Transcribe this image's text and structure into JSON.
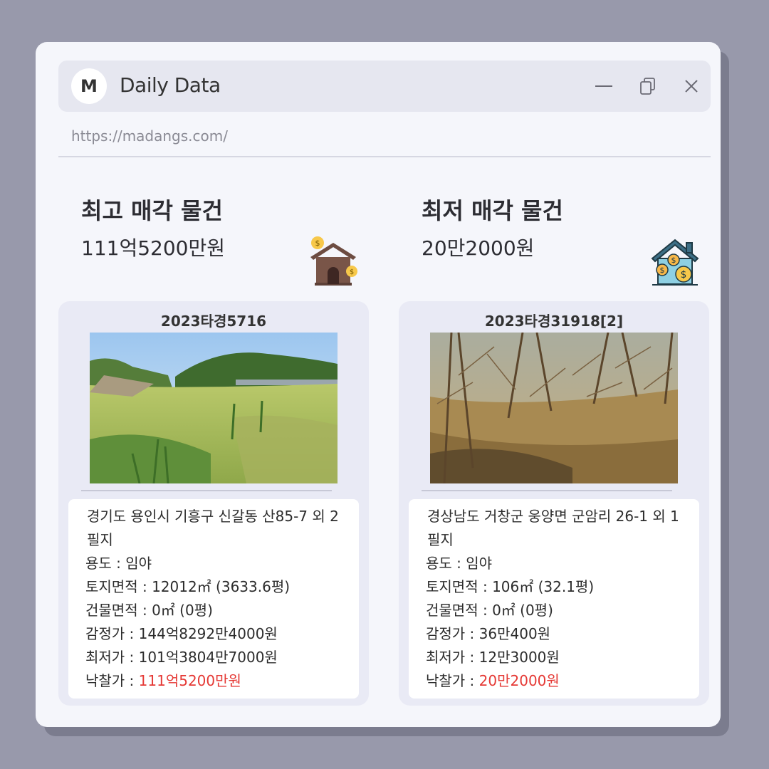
{
  "window": {
    "avatar_letter": "M",
    "title": "Daily Data",
    "url": "https://madangs.com/"
  },
  "highest": {
    "heading": "최고 매각 물건",
    "price": "111억5200만원",
    "case_id": "2023타경5716",
    "address": "경기도 용인시 기흥구 신갈동 산85-7 외 2 필지",
    "usage_label": "용도 : ",
    "usage": "임야",
    "land_label": "토지면적 : ",
    "land_area": "12012㎡ (3633.6평)",
    "building_label": "건물면적 : ",
    "building_area": "0㎡ (0평)",
    "appraisal_label": "감정가 : ",
    "appraisal": "144억8292만4000원",
    "minimum_label": "최저가 : ",
    "minimum": "101억3804만7000원",
    "winning_label": "낙찰가 : ",
    "winning": "111억5200만원"
  },
  "lowest": {
    "heading": "최저 매각 물건",
    "price": "20만2000원",
    "case_id": "2023타경31918[2]",
    "address": "경상남도 거창군 웅양면 군암리 26-1 외 1 필지",
    "usage_label": "용도 : ",
    "usage": "임야",
    "land_label": "토지면적 : ",
    "land_area": "106㎡ (32.1평)",
    "building_label": "건물면적 : ",
    "building_area": "0㎡ (0평)",
    "appraisal_label": "감정가 : ",
    "appraisal": "36만400원",
    "minimum_label": "최저가 : ",
    "minimum": "12만3000원",
    "winning_label": "낙찰가 : ",
    "winning": "20만2000원"
  },
  "icons": {
    "minimize": "minimize-icon",
    "copy": "copy-icon",
    "close": "close-icon",
    "house_money": "house-money-icon",
    "house_coins": "house-coins-icon"
  },
  "colors": {
    "accent_red": "#e53935",
    "background": "#9899ab",
    "window": "#f5f6fb",
    "card": "#e9eaf5"
  }
}
